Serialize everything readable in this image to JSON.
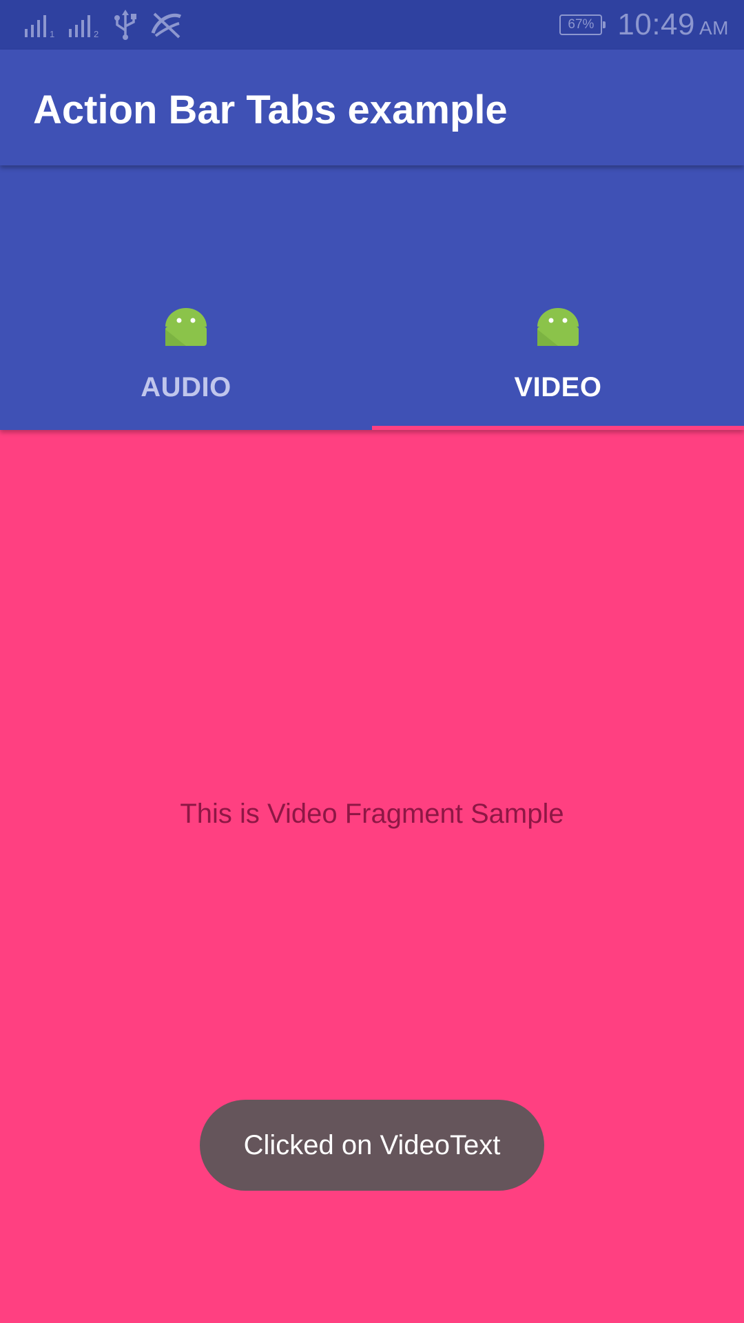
{
  "status_bar": {
    "signal_1_sub": "1",
    "signal_2_sub": "2",
    "battery": "67%",
    "time": "10:49",
    "ampm": "AM"
  },
  "toolbar": {
    "title": "Action Bar Tabs example"
  },
  "tabs": [
    {
      "label": "AUDIO",
      "icon": "android-icon",
      "selected": false
    },
    {
      "label": "VIDEO",
      "icon": "android-icon",
      "selected": true
    }
  ],
  "content": {
    "text": "This is Video Fragment Sample"
  },
  "toast": {
    "text": "Clicked on VideoText"
  },
  "colors": {
    "status_bar": "#2f41a0",
    "primary": "#3f51b5",
    "accent": "#ff4081",
    "android_green": "#8bc34a",
    "toast_bg": "#65555b",
    "fragment_text": "#8e1745"
  }
}
